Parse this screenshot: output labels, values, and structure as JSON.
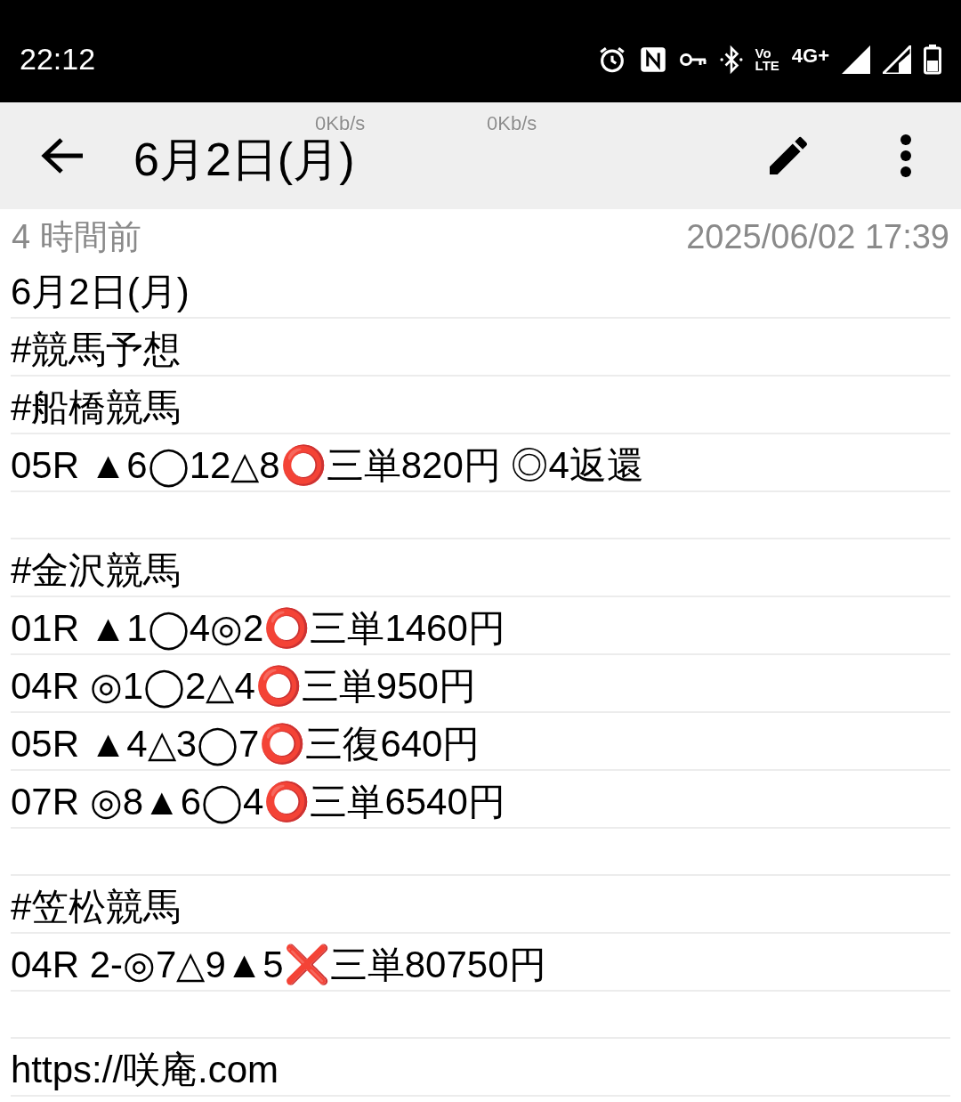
{
  "status_bar": {
    "time": "22:12",
    "volte": [
      "Vo",
      "LTE"
    ],
    "network": "4G+"
  },
  "speed_overlays": [
    "0Kb/s",
    "0Kb/s"
  ],
  "app_bar": {
    "title": "6月2日(月)"
  },
  "meta": {
    "relative_time": "4 時間前",
    "timestamp": "2025/06/02 17:39"
  },
  "lines": [
    {
      "kind": "text",
      "parts": [
        {
          "text": "6月2日(月)"
        }
      ]
    },
    {
      "kind": "text",
      "parts": [
        {
          "text": "#競馬予想"
        }
      ]
    },
    {
      "kind": "text",
      "parts": [
        {
          "text": "#船橋競馬"
        }
      ]
    },
    {
      "kind": "text",
      "parts": [
        {
          "text": "05R ▲6◯12△8"
        },
        {
          "mark": "⭕"
        },
        {
          "text": "三単820円 ◎4返還"
        }
      ]
    },
    {
      "kind": "blank"
    },
    {
      "kind": "text",
      "parts": [
        {
          "text": "#金沢競馬"
        }
      ]
    },
    {
      "kind": "text",
      "parts": [
        {
          "text": "01R ▲1◯4◎2"
        },
        {
          "mark": "⭕"
        },
        {
          "text": "三単1460円"
        }
      ]
    },
    {
      "kind": "text",
      "parts": [
        {
          "text": "04R ◎1◯2△4"
        },
        {
          "mark": "⭕"
        },
        {
          "text": "三単950円"
        }
      ]
    },
    {
      "kind": "text",
      "parts": [
        {
          "text": "05R ▲4△3◯7"
        },
        {
          "mark": "⭕"
        },
        {
          "text": "三復640円"
        }
      ]
    },
    {
      "kind": "text",
      "parts": [
        {
          "text": "07R ◎8▲6◯4"
        },
        {
          "mark": "⭕"
        },
        {
          "text": "三単6540円"
        }
      ]
    },
    {
      "kind": "blank"
    },
    {
      "kind": "text",
      "parts": [
        {
          "text": "#笠松競馬"
        }
      ]
    },
    {
      "kind": "text",
      "parts": [
        {
          "text": "04R 2-◎7△9▲5"
        },
        {
          "mark": "❌"
        },
        {
          "text": "三単80750円"
        }
      ]
    },
    {
      "kind": "blank"
    },
    {
      "kind": "text",
      "parts": [
        {
          "text": "https://咲庵.com"
        }
      ]
    }
  ]
}
